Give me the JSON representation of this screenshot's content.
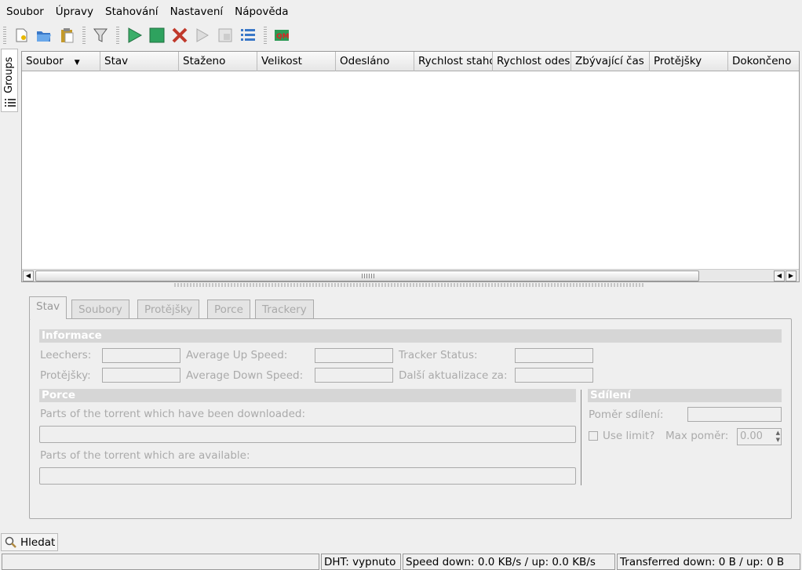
{
  "menu": [
    "Soubor",
    "Úpravy",
    "Stahování",
    "Nastavení",
    "Nápověda"
  ],
  "toolbar": {
    "icons": [
      "new-torrent-icon",
      "open-torrent-icon",
      "paste-icon",
      "filter-icon",
      "start-icon",
      "stop-icon",
      "remove-icon",
      "queue-icon",
      "queue-rearrange-icon",
      "properties-icon",
      "qm-icon"
    ]
  },
  "sidebar": {
    "groups_label": "Groups"
  },
  "table": {
    "columns": [
      "Soubor",
      "Stav",
      "Staženo",
      "Velikost",
      "Odesláno",
      "Rychlost stahování",
      "Rychlost odesílání",
      "Zbývající čas",
      "Protějšky",
      "Dokončeno"
    ]
  },
  "tabs": [
    "Stav",
    "Soubory",
    "Protějšky",
    "Porce",
    "Trackery"
  ],
  "status": {
    "info_title": "Informace",
    "leechers": "Leechers:",
    "avg_up": "Average Up Speed:",
    "tracker_status": "Tracker Status:",
    "peers": "Protějšky:",
    "avg_down": "Average Down Speed:",
    "next_update": "Další aktualizace za:",
    "pieces_title": "Porce",
    "downloaded_parts": "Parts of the torrent which have been downloaded:",
    "available_parts": "Parts of the torrent which are available:",
    "share_title": "Sdílení",
    "share_ratio": "Poměr sdílení:",
    "use_limit": "Use limit?",
    "max_ratio": "Max poměr:",
    "max_ratio_value": "0.00"
  },
  "search_button": "Hledat",
  "statusbar": {
    "dht": "DHT: vypnuto",
    "speed": "Speed down: 0.0 KB/s / up: 0.0 KB/s",
    "transferred": "Transferred down: 0 B / up: 0 B"
  }
}
